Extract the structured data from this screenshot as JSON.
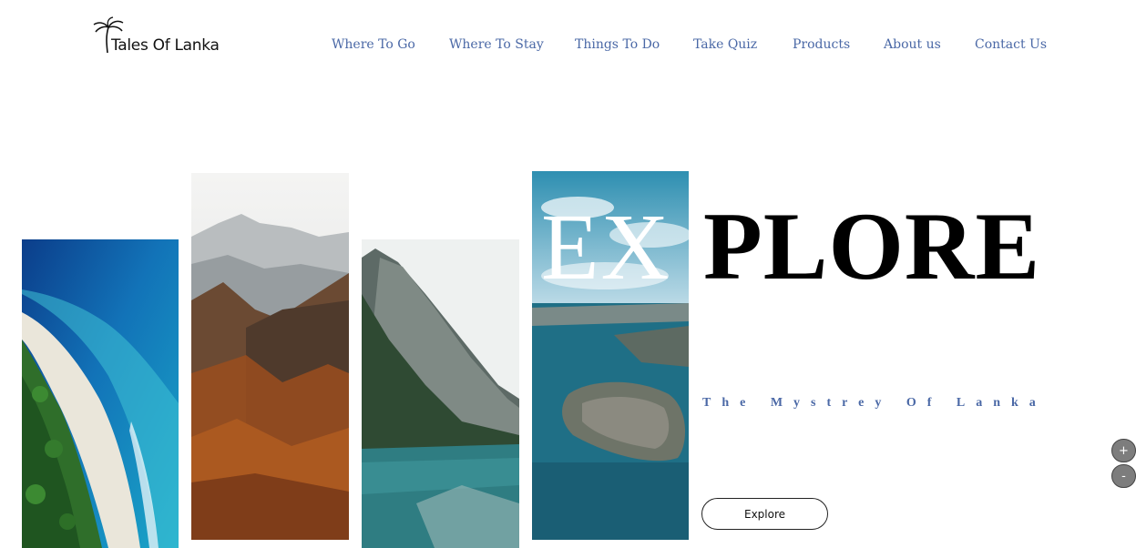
{
  "brand": {
    "name": "Tales Of Lanka"
  },
  "nav": {
    "items": [
      "Where To Go",
      "Where To Stay",
      "Things To Do",
      "Take Quiz",
      "Products",
      "About us",
      "Contact Us"
    ]
  },
  "hero": {
    "title_part1": "EX",
    "title_part2": "PLORE",
    "tagline": "The Mystrey Of Lanka",
    "button_label": "Explore"
  },
  "zoom": {
    "in_label": "+",
    "out_label": "-"
  },
  "colors": {
    "nav_text": "#4a68a6",
    "tagline": "#4a68a6",
    "title": "#000000"
  }
}
